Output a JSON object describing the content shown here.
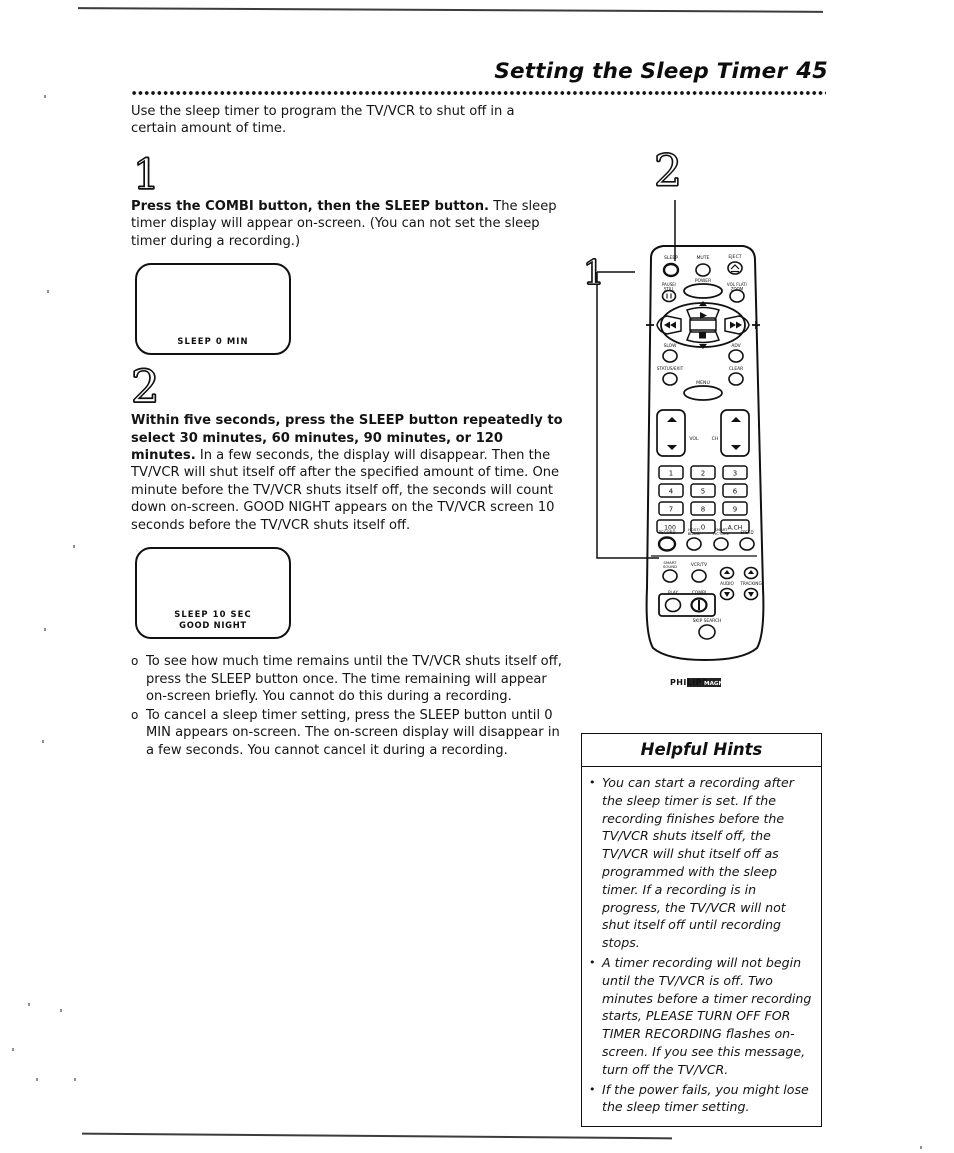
{
  "header": {
    "title": "Setting the Sleep Timer",
    "page_number": "45"
  },
  "intro": "Use the sleep timer to program the TV/VCR to shut off in a certain amount of time.",
  "steps": [
    {
      "number": "1",
      "lead": "Press the COMBI button, then the SLEEP button.",
      "rest": " The sleep timer display will appear on-screen. (You can not set the sleep timer during a recording.)",
      "screen": {
        "line1": "SLEEP   0   MIN",
        "line2": ""
      }
    },
    {
      "number": "2",
      "lead": "Within five seconds, press the SLEEP button repeatedly to select 30 minutes, 60 minutes, 90 minutes, or 120 minutes.",
      "rest": " In a few seconds, the display will disappear. Then the TV/VCR will shut itself off after the specified amount of time. One minute before the TV/VCR shuts itself off, the seconds will count down on-screen. GOOD NIGHT appears on the TV/VCR screen 10 seconds before the TV/VCR shuts itself off.",
      "screen": {
        "line1": "SLEEP   10   SEC",
        "line2": "GOOD NIGHT"
      }
    }
  ],
  "bullets": [
    {
      "marker": "o",
      "text": "To see how much time remains until the TV/VCR shuts itself off, press the SLEEP button once. The time remaining will appear on-screen briefly. You cannot do this during a recording."
    },
    {
      "marker": "o",
      "text": "To cancel a sleep timer setting, press the SLEEP button until 0 MIN appears on-screen. The on-screen display will disappear in a few seconds. You cannot cancel it during a recording."
    }
  ],
  "hints": {
    "title": "Helpful Hints",
    "items": [
      {
        "marker": "•",
        "text": "You can start a recording after the sleep timer is set. If the recording finishes before the TV/VCR shuts itself off, the TV/VCR will shut itself off as programmed with the sleep timer. If a recording is in progress, the TV/VCR will not shut itself off until recording stops."
      },
      {
        "marker": "•",
        "text": "A timer recording will not begin until the TV/VCR is off. Two minutes before a timer recording starts, PLEASE TURN OFF FOR TIMER RECORDING flashes on-screen. If you see this message, turn off the TV/VCR."
      },
      {
        "marker": "•",
        "text": "If the power fails, you might lose the sleep timer setting."
      }
    ]
  },
  "remote": {
    "callout_step2": "2",
    "callout_step1": "1",
    "brand": "PHILIPS",
    "sub_brand": "MAGNAVOX",
    "buttons": {
      "sleep": "SLEEP",
      "mute": "MUTE",
      "eject": "EJECT",
      "pause_still": "PAUSE/STILL",
      "power": "POWER",
      "vol_flat_zoom": "VOL FLAT/ZOOM",
      "slow": "SLOW",
      "adv": "ADV",
      "status_exit": "STATUS/EXIT",
      "clear": "CLEAR",
      "menu": "MENU",
      "vol": "VOL",
      "ch": "CH",
      "record": "RECORD",
      "host_blank": "HOST/BLANK",
      "smart_picture": "SMART PICTURE",
      "speed": "SPEED",
      "smart_sound": "SMART SOUND",
      "vcr_tv": "VCR/TV",
      "audio": "AUDIO",
      "tracking": "TRACKING",
      "play": "PLAY",
      "combi": "COMBI",
      "skip_search": "SKIP SEARCH"
    },
    "keypad": [
      "1",
      "2",
      "3",
      "4",
      "5",
      "6",
      "7",
      "8",
      "9",
      "100",
      "0",
      "A.CH"
    ]
  }
}
